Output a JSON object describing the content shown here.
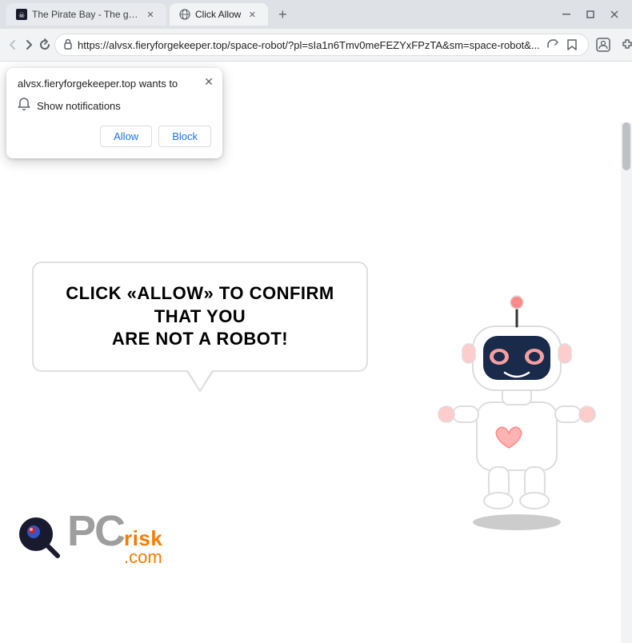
{
  "browser": {
    "tabs": [
      {
        "title": "The Pirate Bay - The galaxy's mo...",
        "active": false,
        "favicon": "pirate"
      },
      {
        "title": "Click Allow",
        "active": true,
        "favicon": "globe"
      }
    ],
    "new_tab_label": "+",
    "address": "https://alvsx.fieryforgekeeper.top/space-robot/?pl=sIa1n6Tmv0meFEZYxFPzTA&sm=space-robot&...",
    "window_controls": {
      "minimize": "─",
      "maximize": "□",
      "close": "✕"
    }
  },
  "notification_popup": {
    "header": "alvsx.fieryforgekeeper.top wants to",
    "notification_label": "Show notifications",
    "allow_button": "Allow",
    "block_button": "Block",
    "close_icon": "✕"
  },
  "page": {
    "bubble_text_line1": "CLICK «ALLOW» TO CONFIRM THAT YOU",
    "bubble_text_line2": "ARE NOT A ROBOT!"
  },
  "pcrisk": {
    "pc_text": "PC",
    "risk_text": "risk",
    "dotcom_text": ".com"
  },
  "colors": {
    "accent_blue": "#1a73e8",
    "orange": "#f57c00",
    "gray": "#9e9e9e"
  }
}
